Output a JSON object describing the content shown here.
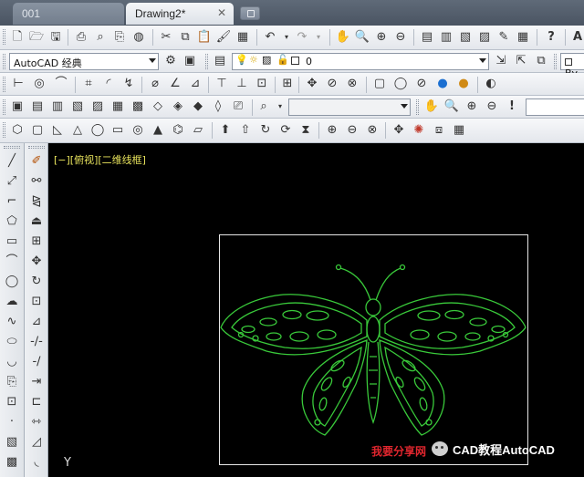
{
  "tabs": [
    {
      "label": "001",
      "active": false
    },
    {
      "label": "Drawing2*",
      "active": true
    }
  ],
  "tab_close_glyph": "✕",
  "workspace": {
    "value": "AutoCAD 经典"
  },
  "layer": {
    "value": "0"
  },
  "property_combo": {
    "value": "By"
  },
  "viewport": {
    "label": "[−][俯视][二维线框]"
  },
  "ucs": {
    "y_label": "Y"
  },
  "watermark": {
    "left_text": "我要分享网",
    "right_text": "CAD教程AutoCAD"
  },
  "colors": {
    "canvas_bg": "#000000",
    "drawing_lines": "#39c93a",
    "viewport_label": "#e8e35c",
    "watermark_red": "#e0262e"
  }
}
